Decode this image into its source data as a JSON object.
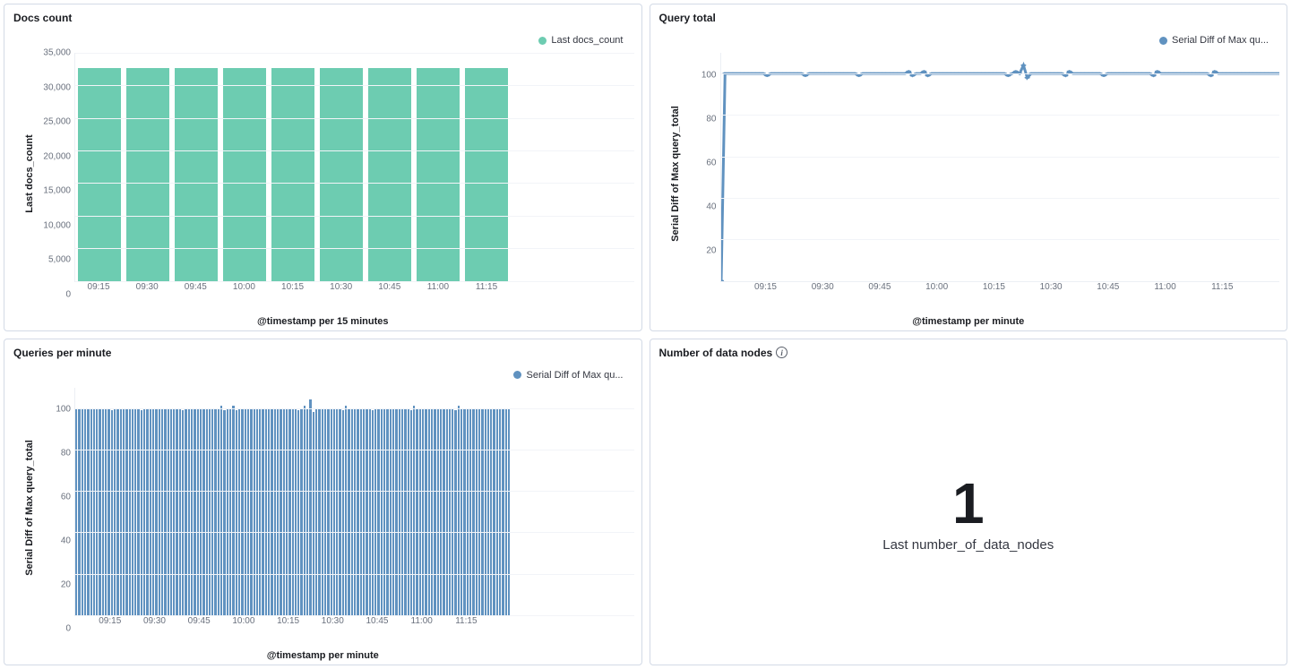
{
  "panels": {
    "docs_count": {
      "title": "Docs count",
      "legend": "Last docs_count",
      "ylabel": "Last docs_count",
      "xlabel": "@timestamp per 15 minutes"
    },
    "query_total": {
      "title": "Query total",
      "legend": "Serial Diff of Max qu...",
      "ylabel": "Serial Diff of Max query_total",
      "xlabel": "@timestamp per minute"
    },
    "queries_per_minute": {
      "title": "Queries per minute",
      "legend": "Serial Diff of Max qu...",
      "ylabel": "Serial Diff of Max query_total",
      "xlabel": "@timestamp per minute"
    },
    "data_nodes": {
      "title": "Number of data nodes",
      "value": "1",
      "label": "Last number_of_data_nodes"
    }
  },
  "chart_data": [
    {
      "id": "docs_count",
      "type": "bar",
      "title": "Docs count",
      "xlabel": "@timestamp per 15 minutes",
      "ylabel": "Last docs_count",
      "categories": [
        "09:15",
        "09:30",
        "09:45",
        "10:00",
        "10:15",
        "10:30",
        "10:45",
        "11:00",
        "11:15"
      ],
      "series": [
        {
          "name": "Last docs_count",
          "color": "#6dccb1",
          "values": [
            32702,
            32702,
            32702,
            32702,
            32702,
            32702,
            32702,
            32702,
            32702
          ]
        }
      ],
      "ylim": [
        0,
        35000
      ],
      "yticks": [
        0,
        5000,
        10000,
        15000,
        20000,
        25000,
        30000,
        35000
      ],
      "xticks": [
        "09:15",
        "09:30",
        "09:45",
        "10:00",
        "10:15",
        "10:30",
        "10:45",
        "11:00",
        "11:15"
      ],
      "legend_position": "top-right"
    },
    {
      "id": "query_total",
      "type": "line",
      "title": "Query total",
      "xlabel": "@timestamp per minute",
      "ylabel": "Serial Diff of Max query_total",
      "x_range_minutes": [
        "09:03",
        "11:30"
      ],
      "series": [
        {
          "name": "Serial Diff of Max query_total",
          "color": "#6092c0",
          "values_note": "Starts at 0 at first point, jumps to ~100, stays ~100 with tiny ±2 jitter; small spike ~104 near 10:23",
          "approx_values": [
            0,
            100,
            100,
            100,
            100,
            100,
            100,
            100,
            100,
            100,
            100,
            100,
            99,
            100,
            100,
            100,
            100,
            100,
            100,
            100,
            100,
            100,
            99,
            100,
            100,
            100,
            100,
            100,
            100,
            100,
            100,
            100,
            100,
            100,
            100,
            100,
            99,
            100,
            100,
            100,
            100,
            100,
            100,
            100,
            100,
            100,
            100,
            100,
            100,
            101,
            99,
            100,
            100,
            101,
            99,
            100,
            100,
            100,
            100,
            100,
            100,
            100,
            100,
            100,
            100,
            100,
            100,
            100,
            100,
            100,
            100,
            100,
            100,
            100,
            100,
            99,
            100,
            101,
            100,
            104,
            98,
            100,
            100,
            100,
            100,
            100,
            100,
            100,
            100,
            100,
            99,
            101,
            100,
            100,
            100,
            100,
            100,
            100,
            100,
            100,
            99,
            100,
            100,
            100,
            100,
            100,
            100,
            100,
            100,
            100,
            100,
            100,
            100,
            99,
            101,
            100,
            100,
            100,
            100,
            100,
            100,
            100,
            100,
            100,
            100,
            100,
            100,
            100,
            99,
            101,
            100,
            100,
            100,
            100,
            100,
            100,
            100,
            100,
            100,
            100,
            100,
            100,
            100,
            100,
            100,
            100,
            100
          ]
        }
      ],
      "ylim": [
        0,
        110
      ],
      "yticks": [
        20,
        40,
        60,
        80,
        100
      ],
      "xticks": [
        "09:15",
        "09:30",
        "09:45",
        "10:00",
        "10:15",
        "10:30",
        "10:45",
        "11:00",
        "11:15"
      ],
      "legend_position": "top-right"
    },
    {
      "id": "queries_per_minute",
      "type": "bar",
      "title": "Queries per minute",
      "xlabel": "@timestamp per minute",
      "ylabel": "Serial Diff of Max query_total",
      "x_range_minutes": [
        "09:03",
        "11:30"
      ],
      "series": [
        {
          "name": "Serial Diff of Max query_total",
          "color": "#6092c0",
          "approx_values": [
            100,
            100,
            100,
            100,
            100,
            100,
            100,
            100,
            100,
            100,
            100,
            100,
            99,
            100,
            100,
            100,
            100,
            100,
            100,
            100,
            100,
            100,
            99,
            100,
            100,
            100,
            100,
            100,
            100,
            100,
            100,
            100,
            100,
            100,
            100,
            100,
            99,
            100,
            100,
            100,
            100,
            100,
            100,
            100,
            100,
            100,
            100,
            100,
            100,
            101,
            99,
            100,
            100,
            101,
            99,
            100,
            100,
            100,
            100,
            100,
            100,
            100,
            100,
            100,
            100,
            100,
            100,
            100,
            100,
            100,
            100,
            100,
            100,
            100,
            100,
            99,
            100,
            101,
            100,
            104,
            98,
            100,
            100,
            100,
            100,
            100,
            100,
            100,
            100,
            100,
            99,
            101,
            100,
            100,
            100,
            100,
            100,
            100,
            100,
            100,
            99,
            100,
            100,
            100,
            100,
            100,
            100,
            100,
            100,
            100,
            100,
            100,
            100,
            99,
            101,
            100,
            100,
            100,
            100,
            100,
            100,
            100,
            100,
            100,
            100,
            100,
            100,
            100,
            99,
            101,
            100,
            100,
            100,
            100,
            100,
            100,
            100,
            100,
            100,
            100,
            100,
            100,
            100,
            100,
            100,
            100,
            100
          ]
        }
      ],
      "ylim": [
        0,
        110
      ],
      "yticks": [
        0,
        20,
        40,
        60,
        80,
        100
      ],
      "xticks": [
        "09:15",
        "09:30",
        "09:45",
        "10:00",
        "10:15",
        "10:30",
        "10:45",
        "11:00",
        "11:15"
      ],
      "legend_position": "top-right"
    },
    {
      "id": "data_nodes",
      "type": "metric",
      "title": "Number of data nodes",
      "value": 1,
      "label": "Last number_of_data_nodes"
    }
  ]
}
